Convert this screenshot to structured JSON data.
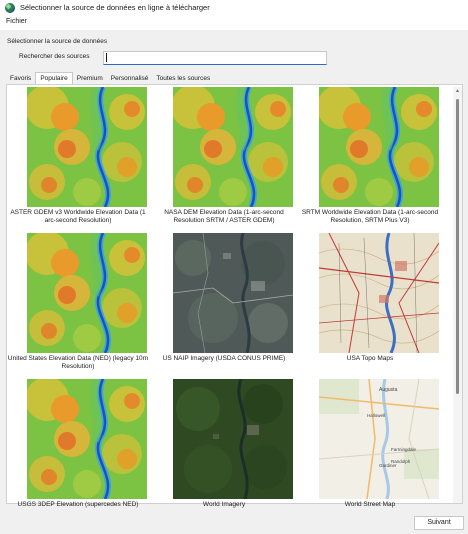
{
  "window": {
    "title": "Sélectionner la source de données en ligne à télécharger"
  },
  "menu": {
    "file": "Fichier"
  },
  "form": {
    "section_label": "Sélectionner la source de données",
    "search_label": "Rechercher des sources",
    "search_value": ""
  },
  "tabs": [
    "Favoris",
    "Populaire",
    "Premium",
    "Personnalisé",
    "Toutes les sources"
  ],
  "active_tab": "Populaire",
  "sources": [
    {
      "label": "ASTER GDEM v3 Worldwide Elevation Data (1 arc-second Resolution)",
      "thumbnail": "elevation-map"
    },
    {
      "label": "NASA DEM Elevation Data (1-arc-second Resolution SRTM / ASTER GDEM)",
      "thumbnail": "elevation-map"
    },
    {
      "label": "SRTM Worldwide Elevation Data (1-arc-second Resolution, SRTM Plus V3)",
      "thumbnail": "elevation-map"
    },
    {
      "label": "United States Elevation Data (NED) (legacy 10m Resolution)",
      "thumbnail": "elevation-map"
    },
    {
      "label": "US NAIP Imagery (USDA CONUS PRIME)",
      "thumbnail": "aerial-imagery"
    },
    {
      "label": "USA Topo Maps",
      "thumbnail": "topo-map"
    },
    {
      "label": "USGS 3DEP Elevation (supercedes NED)",
      "thumbnail": "elevation-map"
    },
    {
      "label": "World Imagery",
      "thumbnail": "satellite-imagery"
    },
    {
      "label": "World Street Map",
      "thumbnail": "street-map"
    }
  ],
  "street_map_labels": [
    "Augusta",
    "Hallowell",
    "Farmingdale",
    "Gardiner",
    "Randolph"
  ],
  "buttons": {
    "next": "Suivant"
  },
  "colors": {
    "accent": "#2b6cc4",
    "panel_bg": "#ffffff",
    "window_bg": "#f0f0f0"
  }
}
